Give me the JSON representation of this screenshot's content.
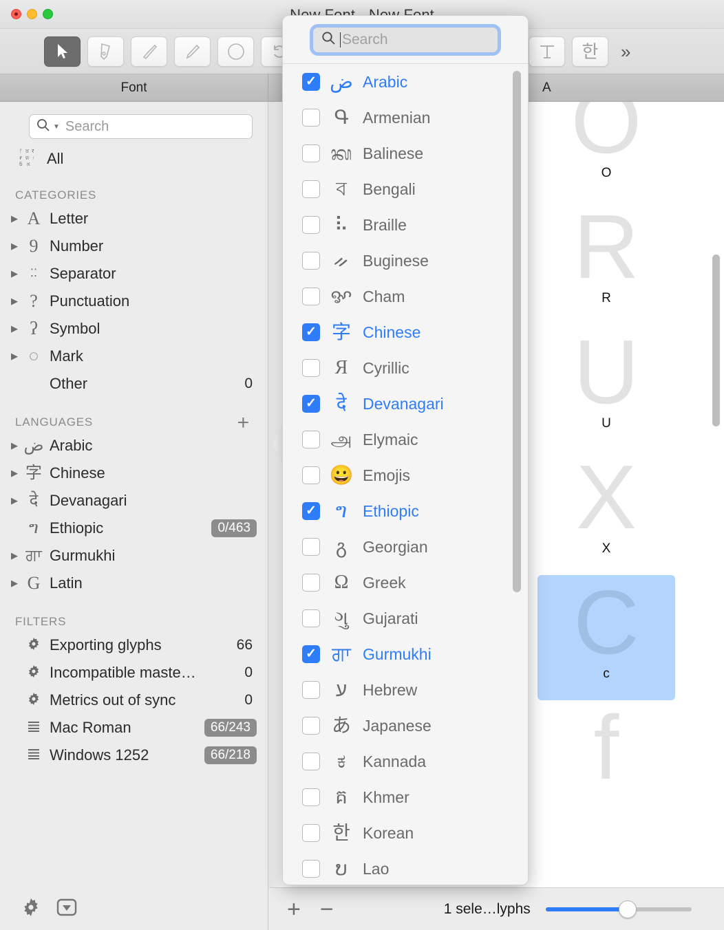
{
  "window": {
    "title": "New Font - New Font",
    "traffic_lights": [
      "close",
      "minimize",
      "zoom"
    ]
  },
  "toolbar": {
    "items": [
      {
        "name": "select-tool",
        "icon": "arrow-cursor-icon",
        "selected": true
      },
      {
        "name": "pen-tool",
        "icon": "pen-nib-icon",
        "selected": false
      },
      {
        "name": "knife-tool",
        "icon": "knife-icon",
        "selected": false
      },
      {
        "name": "pencil-tool",
        "icon": "pencil-icon",
        "selected": false
      },
      {
        "name": "shape-tool",
        "icon": "circle-icon",
        "selected": false
      },
      {
        "name": "rotate-tool",
        "icon": "undo-arrow-icon",
        "selected": false
      },
      {
        "name": "measure-tool",
        "icon": "ruler-icon",
        "selected": false
      },
      {
        "name": "annotate-tool",
        "icon": "pen-stamp-icon",
        "selected": false
      },
      {
        "name": "text-tool",
        "icon": "text-tee-icon",
        "selected": false
      },
      {
        "name": "hangul-tool",
        "icon": "korean-han-icon",
        "selected": false
      }
    ],
    "overflow_label": "»"
  },
  "column_headers": {
    "font": "Font",
    "glyph": "A"
  },
  "sidebar": {
    "search": {
      "placeholder": "Search",
      "value": ""
    },
    "all_label": "All",
    "categories": {
      "title": "CATEGORIES",
      "items": [
        {
          "label": "Letter",
          "icon": "letter-a-icon",
          "glyph": "A",
          "serif": true,
          "expandable": true,
          "count": ""
        },
        {
          "label": "Number",
          "icon": "number-nine-icon",
          "glyph": "9",
          "serif": true,
          "expandable": true,
          "count": ""
        },
        {
          "label": "Separator",
          "icon": "separator-dots-icon",
          "glyph": "⠇⠐",
          "serif": false,
          "expandable": true,
          "count": ""
        },
        {
          "label": "Punctuation",
          "icon": "question-mark-icon",
          "glyph": "?",
          "serif": true,
          "expandable": true,
          "count": ""
        },
        {
          "label": "Symbol",
          "icon": "pilcrow-icon",
          "glyph": "ʔ",
          "serif": true,
          "expandable": true,
          "count": ""
        },
        {
          "label": "Mark",
          "icon": "dotted-circle-mark-icon",
          "glyph": "◌",
          "serif": false,
          "expandable": true,
          "count": ""
        },
        {
          "label": "Other",
          "icon": "",
          "glyph": "",
          "serif": false,
          "expandable": false,
          "count": "0"
        }
      ]
    },
    "languages": {
      "title": "LANGUAGES",
      "add_label": "+",
      "items": [
        {
          "label": "Arabic",
          "glyph": "ض",
          "expandable": true,
          "pill": ""
        },
        {
          "label": "Chinese",
          "glyph": "字",
          "expandable": true,
          "pill": ""
        },
        {
          "label": "Devanagari",
          "glyph": "दे",
          "expandable": true,
          "pill": ""
        },
        {
          "label": "Ethiopic",
          "glyph": "ግ",
          "expandable": false,
          "pill": "0/463"
        },
        {
          "label": "Gurmukhi",
          "glyph": "ਗਾ",
          "expandable": true,
          "pill": ""
        },
        {
          "label": "Latin",
          "glyph": "G",
          "expandable": true,
          "pill": ""
        }
      ]
    },
    "filters": {
      "title": "FILTERS",
      "items": [
        {
          "label": "Exporting glyphs",
          "icon": "gear-icon",
          "count": "66",
          "pill": ""
        },
        {
          "label": "Incompatible maste…",
          "icon": "gear-icon",
          "count": "0",
          "pill": ""
        },
        {
          "label": "Metrics out of sync",
          "icon": "gear-icon",
          "count": "0",
          "pill": ""
        },
        {
          "label": "Mac Roman",
          "icon": "lines-icon",
          "count": "",
          "pill": "66/243"
        },
        {
          "label": "Windows 1252",
          "icon": "lines-icon",
          "count": "",
          "pill": "66/218"
        }
      ]
    },
    "footer": {
      "settings_icon": "gear-icon",
      "actions_icon": "dropdown-box-icon"
    }
  },
  "glyph_panel": {
    "cells": [
      {
        "glyph": "O",
        "label": "O",
        "selected": false
      },
      {
        "glyph": "R",
        "label": "R",
        "selected": false
      },
      {
        "glyph": "U",
        "label": "U",
        "selected": false
      },
      {
        "glyph": "X",
        "label": "X",
        "selected": false
      },
      {
        "glyph": "C",
        "label": "c",
        "selected": true
      },
      {
        "glyph": "f",
        "label": "",
        "selected": false
      }
    ]
  },
  "bottom_bar": {
    "add_label": "+",
    "remove_label": "−",
    "status": "1 sele…lyphs",
    "zoom_percent": 56
  },
  "popover": {
    "search": {
      "placeholder": "Search",
      "value": ""
    },
    "rows": [
      {
        "label": "Arabic",
        "glyph": "ض",
        "checked": true,
        "serif": false
      },
      {
        "label": "Armenian",
        "glyph": "Գ",
        "checked": false,
        "serif": false
      },
      {
        "label": "Balinese",
        "glyph": "ᬓ",
        "checked": false,
        "serif": false
      },
      {
        "label": "Bengali",
        "glyph": "ব",
        "checked": false,
        "serif": false
      },
      {
        "label": "Braille",
        "glyph": "⠧",
        "checked": false,
        "serif": false
      },
      {
        "label": "Buginese",
        "glyph": "ᨀ",
        "checked": false,
        "serif": false
      },
      {
        "label": "Cham",
        "glyph": "ꨀ",
        "checked": false,
        "serif": false
      },
      {
        "label": "Chinese",
        "glyph": "字",
        "checked": true,
        "serif": false
      },
      {
        "label": "Cyrillic",
        "glyph": "Я",
        "checked": false,
        "serif": true
      },
      {
        "label": "Devanagari",
        "glyph": "दे",
        "checked": true,
        "serif": false
      },
      {
        "label": "Elymaic",
        "glyph": "அ",
        "checked": false,
        "serif": false
      },
      {
        "label": "Emojis",
        "glyph": "😀",
        "checked": false,
        "serif": false
      },
      {
        "label": "Ethiopic",
        "glyph": "ግ",
        "checked": true,
        "serif": false
      },
      {
        "label": "Georgian",
        "glyph": "გ",
        "checked": false,
        "serif": false
      },
      {
        "label": "Greek",
        "glyph": "Ω",
        "checked": false,
        "serif": true
      },
      {
        "label": "Gujarati",
        "glyph": "ગુ",
        "checked": false,
        "serif": false
      },
      {
        "label": "Gurmukhi",
        "glyph": "ਗਾ",
        "checked": true,
        "serif": false
      },
      {
        "label": "Hebrew",
        "glyph": "ע",
        "checked": false,
        "serif": false
      },
      {
        "label": "Japanese",
        "glyph": "あ",
        "checked": false,
        "serif": false
      },
      {
        "label": "Kannada",
        "glyph": "ಕ",
        "checked": false,
        "serif": false
      },
      {
        "label": "Khmer",
        "glyph": "គ",
        "checked": false,
        "serif": false
      },
      {
        "label": "Korean",
        "glyph": "한",
        "checked": false,
        "serif": false
      },
      {
        "label": "Lao",
        "glyph": "ບ",
        "checked": false,
        "serif": false
      }
    ]
  }
}
